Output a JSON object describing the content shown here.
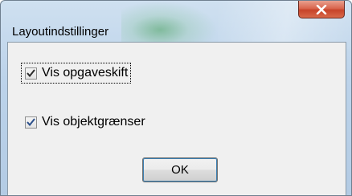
{
  "window": {
    "title": "Layoutindstillinger"
  },
  "options": [
    {
      "label": "Vis opgaveskift",
      "checked": true
    },
    {
      "label": "Vis objektgrænser",
      "checked": true
    }
  ],
  "buttons": {
    "ok_label": "OK"
  },
  "colors": {
    "close_button": "#c7432a",
    "default_button_border": "#3c7fb1"
  }
}
